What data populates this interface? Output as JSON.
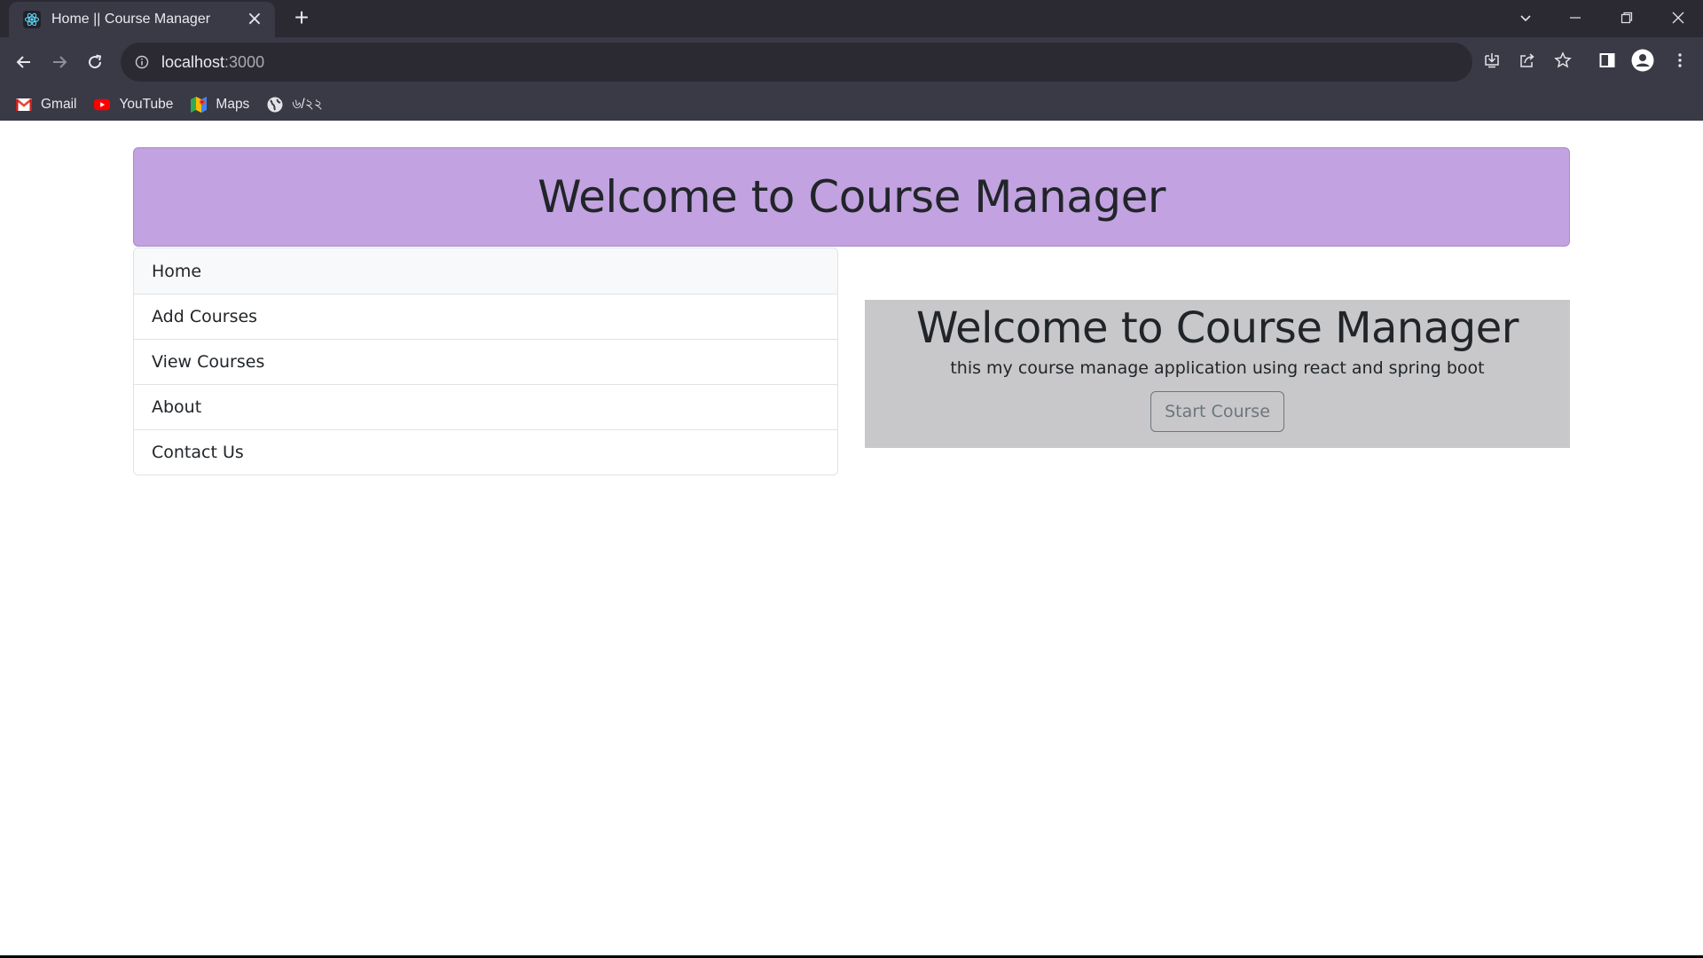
{
  "browser": {
    "tab": {
      "title": "Home || Course Manager",
      "favicon": "react-icon",
      "close_glyph": "×"
    },
    "new_tab_glyph": "+",
    "address": {
      "host": "localhost",
      "port": ":3000"
    },
    "bookmarks": [
      {
        "label": "Gmail",
        "icon": "gmail-icon"
      },
      {
        "label": "YouTube",
        "icon": "youtube-icon"
      },
      {
        "label": "Maps",
        "icon": "maps-icon"
      },
      {
        "label": "৬/২২",
        "icon": "globe-icon"
      }
    ]
  },
  "header": {
    "title": "Welcome to Course Manager",
    "background": "#c2a2e0"
  },
  "menu": {
    "items": [
      {
        "label": "Home"
      },
      {
        "label": "Add Courses"
      },
      {
        "label": "View Courses"
      },
      {
        "label": "About"
      },
      {
        "label": "Contact Us"
      }
    ]
  },
  "jumbotron": {
    "title": "Welcome to Course Manager",
    "description": "this my course manage application using react and spring boot",
    "button_label": "Start Course",
    "background": "#c8c8ca"
  }
}
